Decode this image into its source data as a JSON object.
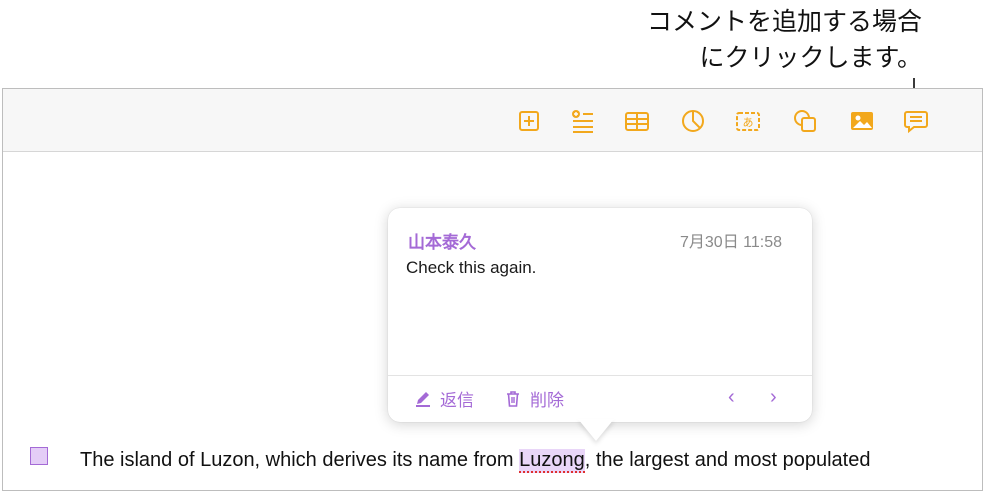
{
  "callout": {
    "line1": "コメントを追加する場合",
    "line2": "にクリックします。"
  },
  "toolbar": {
    "icons": [
      "add-page-icon",
      "text-list-icon",
      "table-icon",
      "chart-icon",
      "text-box-icon",
      "shape-icon",
      "media-icon",
      "comment-icon"
    ]
  },
  "comment": {
    "author": "山本泰久",
    "date": "7月30日 11:58",
    "text": "Check this again.",
    "reply_label": "返信",
    "delete_label": "削除",
    "prev_label": "‹",
    "next_label": "›"
  },
  "document": {
    "before": "The island of Luzon, which derives its name from ",
    "highlight": "Luzong",
    "after": ", the largest and most populated"
  },
  "colors": {
    "accent": "#a46ad6",
    "highlight": "#e9d6f8",
    "toolbar_icon": "#f2a81d"
  }
}
